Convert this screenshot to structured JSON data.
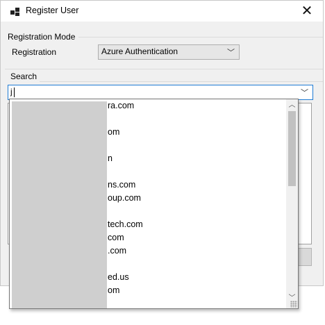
{
  "window": {
    "title": "Register User"
  },
  "registration_mode": {
    "group_label": "Registration Mode",
    "field_label": "Registration",
    "selected": "Azure Authentication"
  },
  "search": {
    "group_label": "Search",
    "value": "j"
  },
  "dropdown": {
    "items": [
      "ra.com",
      "",
      "om",
      "",
      "n",
      "",
      "ns.com",
      "oup.com",
      "",
      "tech.com",
      "com",
      ".com",
      "",
      "ed.us",
      "om"
    ]
  },
  "icons": {
    "app": "windows-app-icon",
    "close": "close-icon",
    "combo": "chevron-down-icon",
    "scroll_up": "chevron-up-icon",
    "scroll_down": "chevron-down-icon"
  }
}
